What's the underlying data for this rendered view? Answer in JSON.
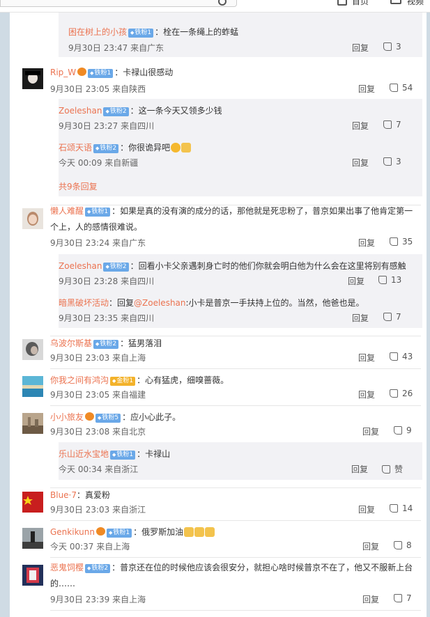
{
  "topbar": {
    "search_placeholder": "",
    "btn1": "首页",
    "btn2": "视频"
  },
  "prev": {
    "name": "困在树上的小孩",
    "badge": "铁粉1",
    "text": "：栓在一条绳上的蚱蜢",
    "time": "9月30日 23:47",
    "from": "来自广东",
    "reply": "回复",
    "likes": "3"
  },
  "comments": [
    {
      "name": "Rip_W",
      "badge": "铁粉1",
      "text": "：卡禄山很感动",
      "time": "9月30日 23:05",
      "from": "来自陕西",
      "reply": "回复",
      "likes": "54",
      "subs": [
        {
          "name": "Zoeleshan",
          "badge": "铁粉2",
          "text": "：这一条今天又领多少钱",
          "time": "9月30日 23:27",
          "from": "来自四川",
          "reply": "回复",
          "likes": "7"
        },
        {
          "name": "石颂天语",
          "badge": "铁粉2",
          "text": "：你很诡异吧",
          "time": "今天 00:09",
          "from": "来自新疆",
          "reply": "回复",
          "likes": "3"
        }
      ],
      "more": "共9条回复"
    },
    {
      "name": "懒人难醒",
      "badge": "铁粉1",
      "text": "：如果是真的没有演的成分的话，那他就是死忠粉了，普京如果出事了他肯定第一个上，人的感情很难说。",
      "time": "9月30日 23:24",
      "from": "来自广东",
      "reply": "回复",
      "likes": "35",
      "subs": [
        {
          "name": "Zoeleshan",
          "badge": "铁粉2",
          "text": "：回看小卡父亲遇刺身亡时的他们你就会明白他为什么会在这里将别有感触",
          "time": "9月30日 23:28",
          "from": "来自四川",
          "reply": "回复",
          "likes": "13"
        },
        {
          "name": "暗黑破坏活动",
          "text": "：回复",
          "mention": "@Zoeleshan",
          "text2": ":小卡是普京一手扶持上位的。当然，他爸也是。",
          "time": "9月30日 23:35",
          "from": "来自四川",
          "reply": "回复",
          "likes": "7"
        }
      ]
    },
    {
      "name": "乌波尔斯基",
      "badge": "铁粉2",
      "text": "：猛男落泪",
      "time": "9月30日 23:03",
      "from": "来自上海",
      "reply": "回复",
      "likes": "43"
    },
    {
      "name": "你我之间有鸿沟",
      "badge": "金粉1",
      "text": "：心有猛虎，细嗅蔷薇。",
      "time": "9月30日 23:05",
      "from": "来自福建",
      "reply": "回复",
      "likes": "26"
    },
    {
      "name": "小小旅友",
      "badge": "铁粉5",
      "text": "：应小心此子。",
      "time": "9月30日 23:08",
      "from": "来自北京",
      "reply": "回复",
      "likes": "9",
      "subs": [
        {
          "name": "乐山近水宝地",
          "badge": "铁粉1",
          "text": "：卡禄山",
          "time": "今天 00:34",
          "from": "来自浙江",
          "reply": "回复",
          "likes": "赞"
        }
      ]
    },
    {
      "name": "Blue·7",
      "text": "：真爱粉",
      "time": "9月30日 23:03",
      "from": "来自浙江",
      "reply": "回复",
      "likes": "14"
    },
    {
      "name": "Genkikunn",
      "badge": "铁粉1",
      "text": "：俄罗斯加油",
      "time": "今天 00:37",
      "from": "来自上海",
      "reply": "回复",
      "likes": "8"
    },
    {
      "name": "恶鬼饲樱",
      "badge": "铁粉2",
      "text": "：普京还在位的时候他应该会很安分，就担心啥时候普京不在了，他又不服新上台的……",
      "time": "9月30日 23:39",
      "from": "来自上海",
      "reply": "回复",
      "likes": "7"
    }
  ]
}
